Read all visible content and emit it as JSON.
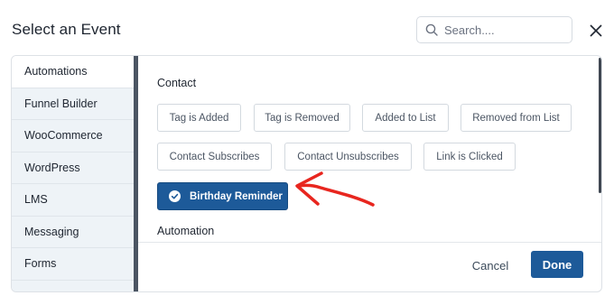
{
  "modal": {
    "title": "Select an Event"
  },
  "search": {
    "placeholder": "Search....",
    "value": ""
  },
  "sidebar": {
    "items": [
      {
        "label": "Automations",
        "active": true
      },
      {
        "label": "Funnel Builder",
        "active": false
      },
      {
        "label": "WooCommerce",
        "active": false
      },
      {
        "label": "WordPress",
        "active": false
      },
      {
        "label": "LMS",
        "active": false
      },
      {
        "label": "Messaging",
        "active": false
      },
      {
        "label": "Forms",
        "active": false
      }
    ]
  },
  "content": {
    "sections": [
      {
        "title": "Contact",
        "events": [
          {
            "label": "Tag is Added",
            "selected": false
          },
          {
            "label": "Tag is Removed",
            "selected": false
          },
          {
            "label": "Added to List",
            "selected": false
          },
          {
            "label": "Removed from List",
            "selected": false
          },
          {
            "label": "Contact Subscribes",
            "selected": false
          },
          {
            "label": "Contact Unsubscribes",
            "selected": false
          },
          {
            "label": "Link is Clicked",
            "selected": false
          },
          {
            "label": "Birthday Reminder",
            "selected": true
          }
        ]
      },
      {
        "title": "Automation",
        "events": []
      }
    ]
  },
  "footer": {
    "cancel_label": "Cancel",
    "done_label": "Done"
  },
  "colors": {
    "accent": "#1d5a99",
    "sidebar_bg": "#eef3f7",
    "annotation_arrow": "#e8261f"
  },
  "icons": {
    "search": "search-icon",
    "close": "close-icon",
    "check": "check-circle-icon",
    "annotation": "arrow-annotation"
  }
}
